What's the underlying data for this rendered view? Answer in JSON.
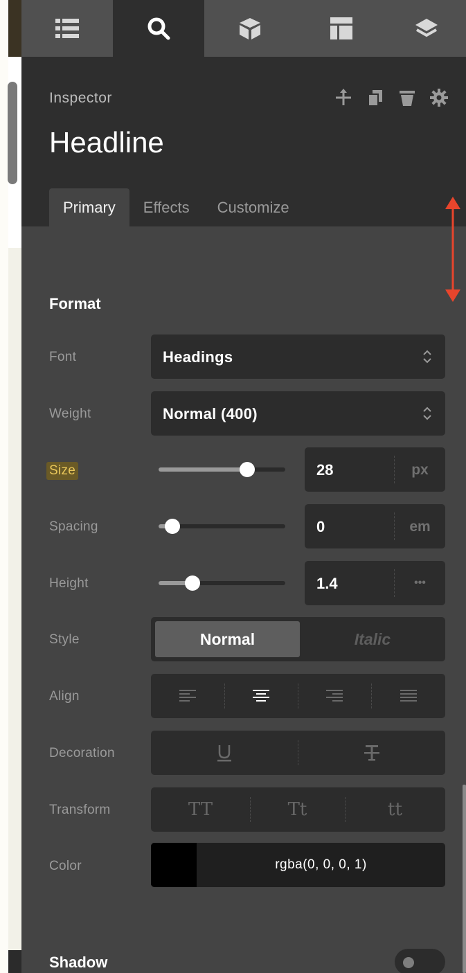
{
  "top_tabs": [
    {
      "icon": "list-icon"
    },
    {
      "icon": "search-icon",
      "active": true
    },
    {
      "icon": "cube-icon"
    },
    {
      "icon": "layout-icon"
    },
    {
      "icon": "layers-icon"
    }
  ],
  "inspector": {
    "label": "Inspector",
    "title": "Headline",
    "header_icons": [
      "move-icon",
      "duplicate-icon",
      "delete-icon",
      "settings-icon"
    ],
    "tabs": [
      "Primary",
      "Effects",
      "Customize"
    ],
    "active_tab": "Primary"
  },
  "format": {
    "title": "Format",
    "font": {
      "label": "Font",
      "value": "Headings"
    },
    "weight": {
      "label": "Weight",
      "value": "Normal (400)"
    },
    "size": {
      "label": "Size",
      "value": "28",
      "unit": "px",
      "slider_fraction": 0.7
    },
    "spacing": {
      "label": "Spacing",
      "value": "0",
      "unit": "em",
      "slider_fraction": 0.11
    },
    "height": {
      "label": "Height",
      "value": "1.4",
      "unit": "•••",
      "slider_fraction": 0.27
    },
    "style": {
      "label": "Style",
      "options": [
        "Normal",
        "Italic"
      ],
      "selected": "Normal"
    },
    "align": {
      "label": "Align",
      "options": [
        "align-left-icon",
        "align-center-icon",
        "align-right-icon",
        "align-justify-icon"
      ],
      "selected": "align-center-icon"
    },
    "decoration": {
      "label": "Decoration",
      "options": [
        "underline-icon",
        "strikethrough-icon"
      ]
    },
    "transform": {
      "label": "Transform",
      "options": [
        "TT",
        "Tt",
        "tt"
      ]
    },
    "color": {
      "label": "Color",
      "value": "rgba(0, 0, 0, 1)",
      "swatch": "#000000"
    }
  },
  "shadow": {
    "title": "Shadow",
    "enabled": false
  },
  "colors": {
    "panel": "#444444",
    "header": "#2e2e2e",
    "accent_arrow": "#e8452c",
    "size_highlight": "#e8c65a"
  }
}
